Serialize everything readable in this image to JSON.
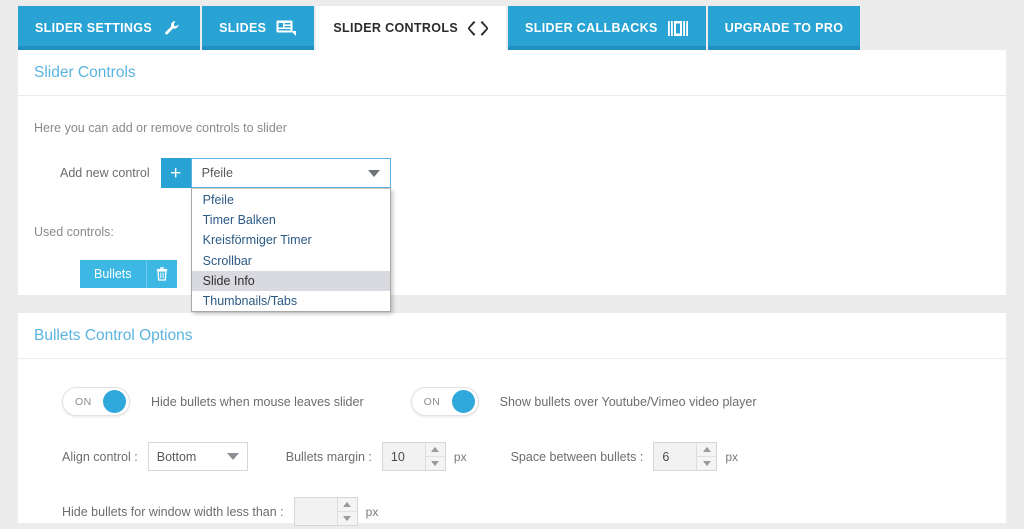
{
  "tabs": [
    {
      "label": "SLIDER SETTINGS",
      "icon": "wrench-icon",
      "active": false
    },
    {
      "label": "SLIDES",
      "icon": "slides-icon",
      "active": false
    },
    {
      "label": "SLIDER CONTROLS",
      "icon": "code-brackets-icon",
      "active": true
    },
    {
      "label": "SLIDER CALLBACKS",
      "icon": "callbacks-bars-icon",
      "active": false
    },
    {
      "label": "UPGRADE TO PRO",
      "icon": "",
      "active": false
    }
  ],
  "controls_panel": {
    "title": "Slider Controls",
    "hint": "Here you can add or remove controls to slider",
    "add_label": "Add new control",
    "add_button": "+",
    "select_value": "Pfeile",
    "options": [
      {
        "label": "Pfeile",
        "highlighted": false
      },
      {
        "label": "Timer Balken",
        "highlighted": false
      },
      {
        "label": "Kreisförmiger Timer",
        "highlighted": false
      },
      {
        "label": "Scrollbar",
        "highlighted": false
      },
      {
        "label": "Slide Info",
        "highlighted": true
      },
      {
        "label": "Thumbnails/Tabs",
        "highlighted": false
      }
    ],
    "used_label": "Used controls:",
    "used_chip": "Bullets",
    "delete_icon": "trash-icon"
  },
  "bullets_panel": {
    "title": "Bullets Control Options",
    "toggle1": {
      "state": "ON",
      "caption": "Hide bullets when mouse leaves slider"
    },
    "toggle2": {
      "state": "ON",
      "caption": "Show bullets over Youtube/Vimeo video player"
    },
    "align": {
      "label": "Align control :",
      "value": "Bottom"
    },
    "margin": {
      "label": "Bullets margin :",
      "value": "10",
      "unit": "px"
    },
    "space": {
      "label": "Space between bullets :",
      "value": "6",
      "unit": "px"
    },
    "hide_width": {
      "label": "Hide bullets for window width less than :",
      "value": "",
      "unit": "px"
    }
  },
  "colors": {
    "tab_blue": "#29a3d4",
    "title_blue": "#5bb4e0",
    "chip_blue": "#3db7e4",
    "page_bg": "#ececec"
  }
}
